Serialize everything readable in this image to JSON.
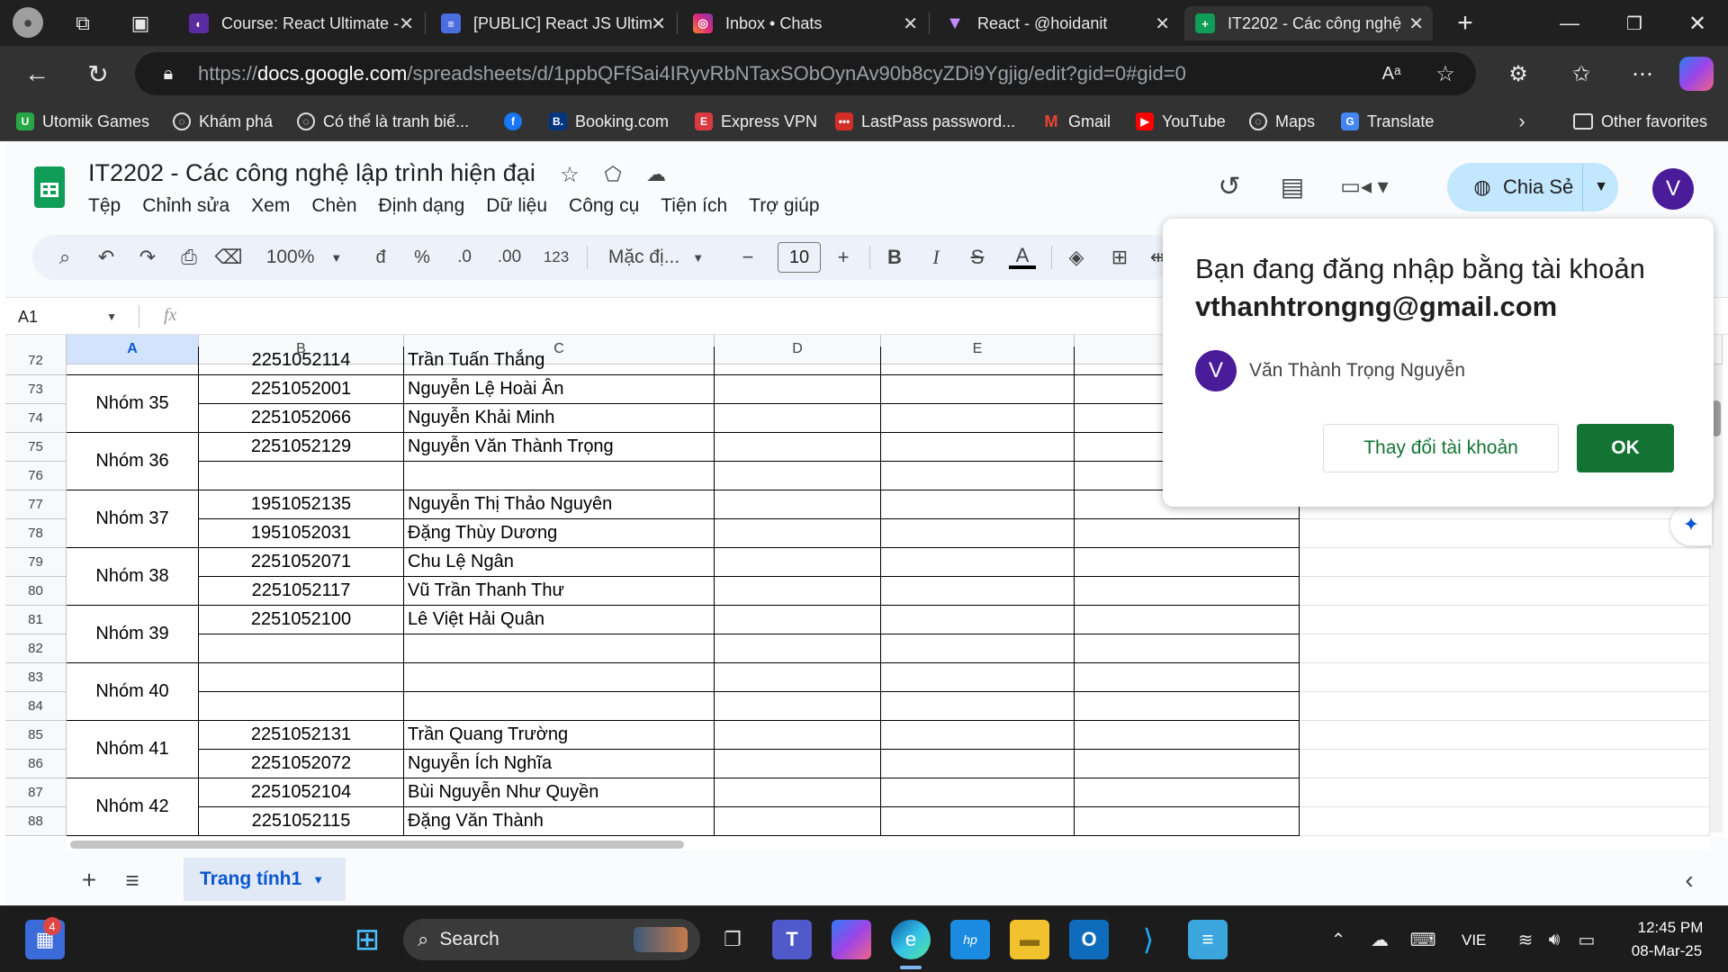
{
  "browser": {
    "tabs": [
      {
        "title": "Course: React Ultimate -",
        "active": false,
        "favicon_color": "#5a2ba1",
        "favicon": "book-icon"
      },
      {
        "title": "[PUBLIC] React JS Ultim",
        "active": false,
        "favicon_color": "#4a6ee0",
        "favicon": "docs-icon"
      },
      {
        "title": "Inbox • Chats",
        "active": false,
        "favicon_color": "#d6249f",
        "favicon": "instagram-icon"
      },
      {
        "title": "React - @hoidanit",
        "active": false,
        "favicon_color": "#c48cff",
        "favicon": "vite-icon"
      },
      {
        "title": "IT2202 - Các công nghệ",
        "active": true,
        "favicon_color": "#0f9d58",
        "favicon": "sheets-icon"
      }
    ],
    "url_prefix": "https://",
    "url_host": "docs.google.com",
    "url_path": "/spreadsheets/d/1ppbQFfSai4IRyvRbNTaxSObOynAv90b8cyZDi9Ygjig/edit?gid=0#gid=0",
    "bookmarks": [
      {
        "label": "Utomik Games",
        "color": "#27a745"
      },
      {
        "label": "Khám phá",
        "color": ""
      },
      {
        "label": "Có thể là tranh biế...",
        "color": ""
      },
      {
        "label": "",
        "color": "#1877f2"
      },
      {
        "label": "Booking.com",
        "color": "#003580"
      },
      {
        "label": "Express VPN",
        "color": "#da3940"
      },
      {
        "label": "LastPass password...",
        "color": "#d32d27"
      },
      {
        "label": "Gmail",
        "color": "#ea4335"
      },
      {
        "label": "YouTube",
        "color": "#ff0000"
      },
      {
        "label": "Maps",
        "color": ""
      },
      {
        "label": "Translate",
        "color": "#4285f4"
      }
    ],
    "other_favorites": "Other favorites"
  },
  "sheets": {
    "doc_title": "IT2202 - Các công nghệ lập trình hiện đại",
    "menus": [
      "Tệp",
      "Chỉnh sửa",
      "Xem",
      "Chèn",
      "Định dạng",
      "Dữ liệu",
      "Công cụ",
      "Tiện ích",
      "Trợ giúp"
    ],
    "share_label": "Chia Sẻ",
    "avatar_letter": "V",
    "toolbar": {
      "zoom": "100%",
      "currency": "đ",
      "percent": "%",
      "dec_less": ".0",
      "dec_more": ".00",
      "number_format": "123",
      "font": "Mặc đị...",
      "font_size": "10",
      "bold": "B",
      "italic": "I",
      "text_color": "A"
    },
    "name_box": "A1",
    "fx": "fx",
    "columns": [
      "A",
      "B",
      "C",
      "D",
      "E"
    ],
    "rows": [
      {
        "num": "72",
        "b": "2251052114",
        "c": "Trần Tuấn Thắng"
      },
      {
        "num": "73",
        "b": "2251052001",
        "c": "Nguyễn Lệ Hoài Ân"
      },
      {
        "num": "74",
        "b": "2251052066",
        "c": "Nguyễn Khải Minh"
      },
      {
        "num": "75",
        "b": "2251052129",
        "c": "Nguyễn Văn Thành Trọng"
      },
      {
        "num": "76",
        "b": "",
        "c": ""
      },
      {
        "num": "77",
        "b": "1951052135",
        "c": "Nguyễn Thị Thảo Nguyên"
      },
      {
        "num": "78",
        "b": "1951052031",
        "c": "Đặng Thùy Dương"
      },
      {
        "num": "79",
        "b": "2251052071",
        "c": "Chu Lệ Ngân"
      },
      {
        "num": "80",
        "b": "2251052117",
        "c": "Vũ Trần Thanh Thư"
      },
      {
        "num": "81",
        "b": "2251052100",
        "c": "Lê Việt Hải Quân"
      },
      {
        "num": "82",
        "b": "",
        "c": ""
      },
      {
        "num": "83",
        "b": "",
        "c": ""
      },
      {
        "num": "84",
        "b": "",
        "c": ""
      },
      {
        "num": "85",
        "b": "2251052131",
        "c": "Trần Quang Trường"
      },
      {
        "num": "86",
        "b": "2251052072",
        "c": "Nguyễn Ích Nghĩa"
      },
      {
        "num": "87",
        "b": "2251052104",
        "c": "Bùi Nguyễn Như Quyền"
      },
      {
        "num": "88",
        "b": "2251052115",
        "c": "Đặng Văn Thành"
      }
    ],
    "groups": [
      "Nhóm 35",
      "Nhóm 36",
      "Nhóm 37",
      "Nhóm 38",
      "Nhóm 39",
      "Nhóm 40",
      "Nhóm 41",
      "Nhóm 42"
    ],
    "sheet_tab": "Trang tính1"
  },
  "popup": {
    "message_line1": "Bạn đang đăng nhập bằng tài khoản",
    "email": "vthanhtrongng@gmail.com",
    "avatar_letter": "V",
    "user_name": "Văn Thành Trọng Nguyễn",
    "change_account": "Thay đổi tài khoản",
    "ok": "OK"
  },
  "taskbar": {
    "notification_count": "4",
    "search_label": "Search",
    "language": "VIE",
    "time": "12:45 PM",
    "date": "08-Mar-25"
  },
  "colors": {
    "sheets_green": "#0f9d58",
    "share_bg": "#c2e7ff",
    "ok_green": "#137333",
    "avatar_purple": "#4a1c9a",
    "sheet_tab_blue": "#0b57d0"
  }
}
